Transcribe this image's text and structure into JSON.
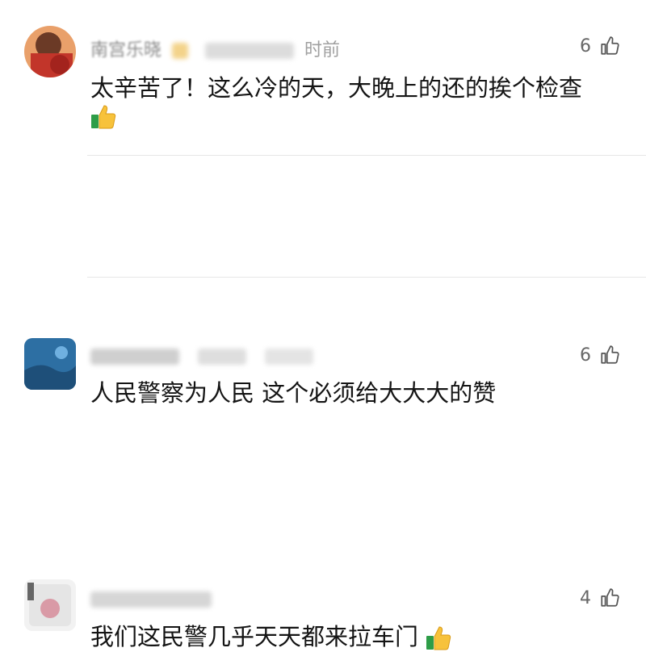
{
  "comments": [
    {
      "username": "南宫乐晓",
      "time": "时前",
      "text": "太辛苦了！这么冷的天，大晚上的还的挨个检查",
      "likes": "6",
      "has_emoji_newline": true
    },
    {
      "username": "",
      "time": "",
      "text": "人民警察为人民  这个必须给大大大的赞",
      "likes": "6"
    },
    {
      "username": "",
      "time": "",
      "text": "我们这民警几乎天天都来拉车门",
      "likes": "4"
    }
  ],
  "icons": {
    "like": "thumbs-up-outline-icon",
    "emoji": "thumbs-up-emoji-icon"
  }
}
